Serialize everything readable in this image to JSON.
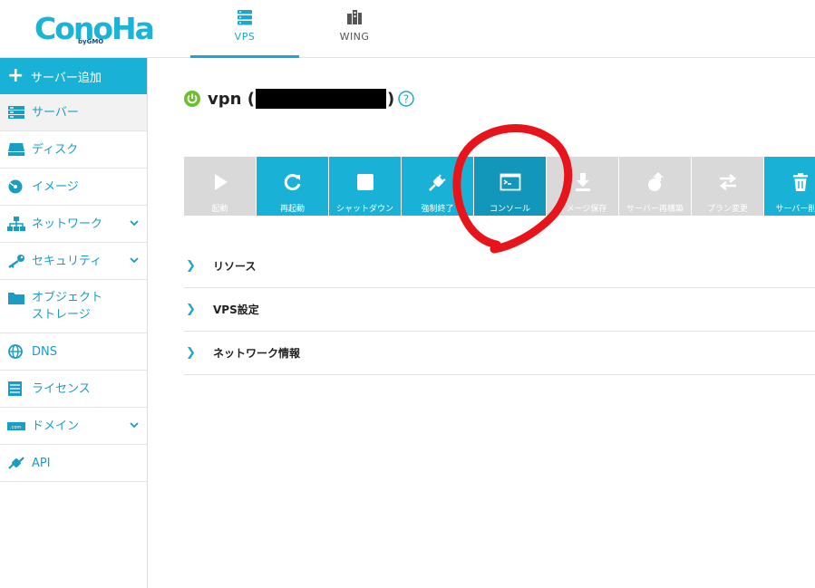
{
  "logo": {
    "text": "ConoHa",
    "sub": "byGMO"
  },
  "top_tabs": [
    {
      "label": "VPS",
      "icon": "server-stack-icon",
      "active": true
    },
    {
      "label": "WING",
      "icon": "building-icon",
      "active": false
    }
  ],
  "sidebar": {
    "add_label": "サーバー追加",
    "items": [
      {
        "label": "サーバー",
        "icon": "server-icon",
        "active": true
      },
      {
        "label": "ディスク",
        "icon": "disk-icon"
      },
      {
        "label": "イメージ",
        "icon": "image-disc-icon"
      },
      {
        "label": "ネットワーク",
        "icon": "network-icon",
        "expandable": true
      },
      {
        "label": "セキュリティ",
        "icon": "key-icon",
        "expandable": true
      },
      {
        "label": "オブジェクト\nストレージ",
        "label_line1": "オブジェクト",
        "label_line2": "ストレージ",
        "icon": "folder-icon"
      },
      {
        "label": "DNS",
        "icon": "globe-icon"
      },
      {
        "label": "ライセンス",
        "icon": "license-icon"
      },
      {
        "label": "ドメイン",
        "icon": "domain-icon",
        "expandable": true
      },
      {
        "label": "API",
        "icon": "api-plug-icon"
      }
    ]
  },
  "server": {
    "status_icon": "power-icon",
    "name_prefix": "vpn (",
    "name_suffix": ")",
    "status_color": "#6cbf2f"
  },
  "actions": [
    {
      "label": "起動",
      "icon": "play-icon",
      "state": "disabled"
    },
    {
      "label": "再起動",
      "icon": "restart-icon",
      "state": "enabled"
    },
    {
      "label": "シャットダウン",
      "icon": "stop-icon",
      "state": "enabled"
    },
    {
      "label": "強制終了",
      "icon": "plug-icon",
      "state": "enabled"
    },
    {
      "label": "コンソール",
      "icon": "console-icon",
      "state": "highlighted"
    },
    {
      "label": "イメージ保存",
      "icon": "download-icon",
      "state": "disabled"
    },
    {
      "label": "サーバー再構築",
      "icon": "rebuild-icon",
      "state": "disabled"
    },
    {
      "label": "プラン変更",
      "icon": "swap-icon",
      "state": "disabled"
    },
    {
      "label": "サーバー削除",
      "icon": "trash-icon",
      "state": "enabled"
    }
  ],
  "sections": [
    {
      "label": "リソース"
    },
    {
      "label": "VPS設定"
    },
    {
      "label": "ネットワーク情報"
    }
  ],
  "colors": {
    "accent": "#19b2d6",
    "console_active": "#1297bb",
    "disabled": "#d9d9d9",
    "annotation": "#e8141c"
  }
}
